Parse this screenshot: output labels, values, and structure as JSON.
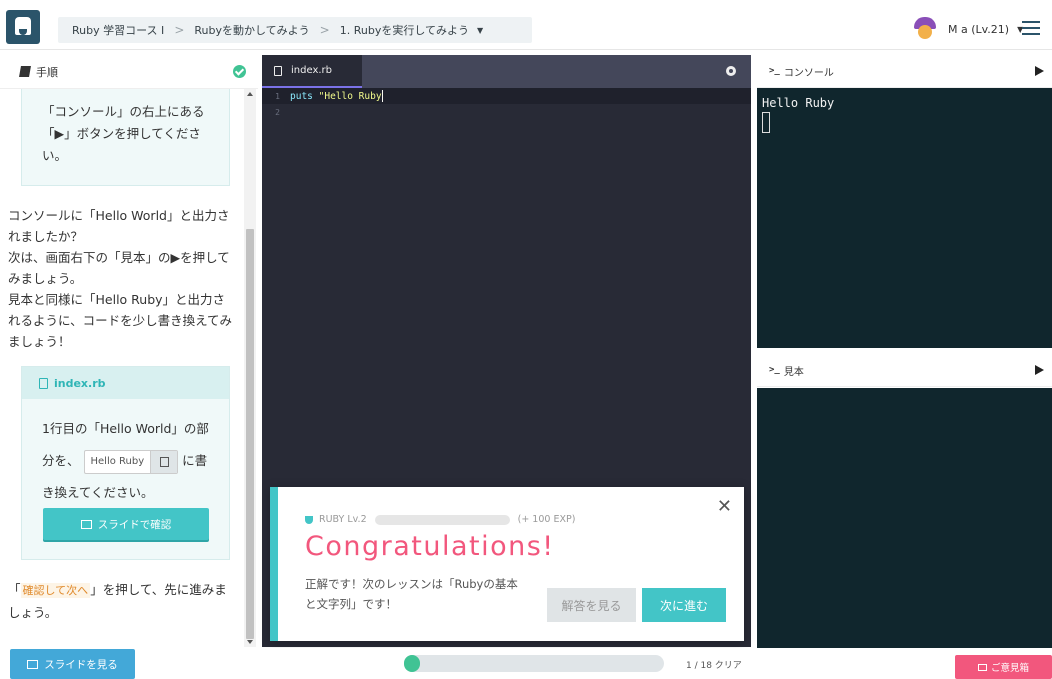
{
  "header": {
    "breadcrumb": [
      "Ruby 学習コース Ⅰ",
      "Rubyを動かしてみよう",
      "1. Rubyを実行してみよう"
    ],
    "user_name": "M a (Lv.21)"
  },
  "left_panel": {
    "title": "手順",
    "box_text": "「コンソール」の右上にある「▶」ボタンを押してください。",
    "paragraph": [
      "コンソールに「Hello World」と出力されましたか？",
      "次は、画面右下の「見本」の▶を押してみましょう。",
      "見本と同様に「Hello Ruby」と出力されるように、コードを少し書き換えてみましょう！"
    ],
    "file_name": "index.rb",
    "instruction_before": "1行目の「Hello World」の部分を、",
    "code_chip": "Hello Ruby",
    "instruction_after": "に書き換えてください。",
    "slide_button": "スライドで確認",
    "bottom_open": "「",
    "bottom_highlight": "確認して次へ",
    "bottom_rest": "」を押して、先に進みましょう。"
  },
  "editor": {
    "tab": "index.rb",
    "lines": [
      {
        "num": "1",
        "kw": "puts",
        "str": "\"Hello Ruby"
      },
      {
        "num": "2"
      }
    ]
  },
  "console": {
    "title": "コンソール",
    "output": "Hello Ruby"
  },
  "sample": {
    "title": "見本"
  },
  "modal": {
    "level": "RUBY Lv.2",
    "exp": "(+ 100 EXP)",
    "title": "Congratulations!",
    "message": "正解です！次のレッスンは「Rubyの基本と文字列」です！",
    "answer_button": "解答を見る",
    "next_button": "次に進む"
  },
  "footer": {
    "slide_button": "スライドを見る",
    "progress": 0.05,
    "progress_text": "1 / 18 クリア",
    "feedback_button": "ご意見箱"
  }
}
